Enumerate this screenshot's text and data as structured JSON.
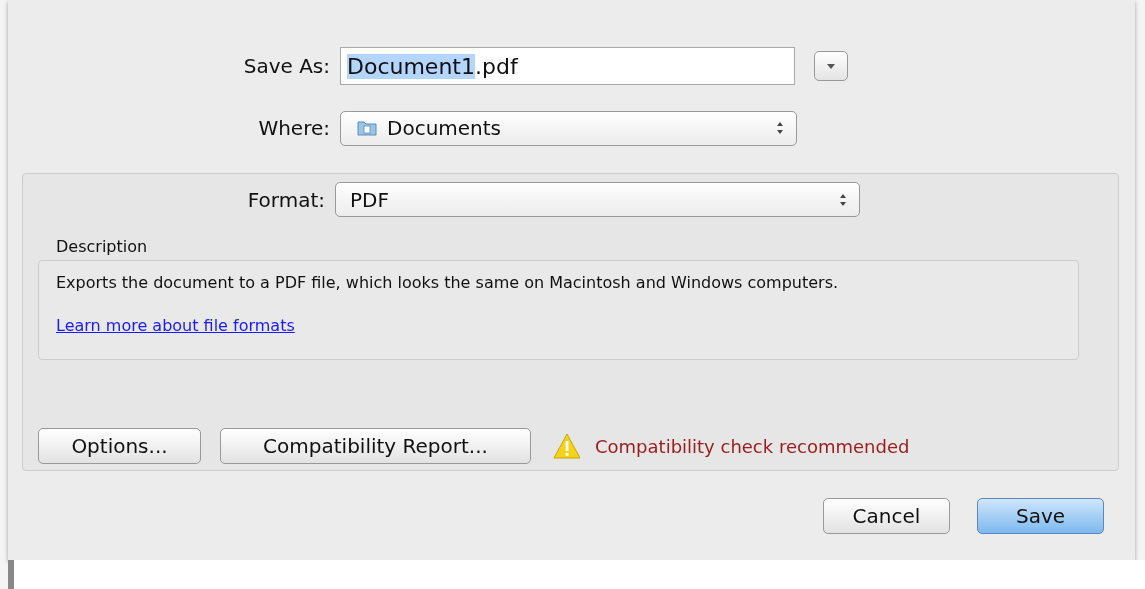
{
  "save_as": {
    "label": "Save As:",
    "name": "Document1",
    "extension": ".pdf",
    "name_selected": true
  },
  "where": {
    "label": "Where:",
    "value": "Documents"
  },
  "format": {
    "label": "Format:",
    "value": "PDF"
  },
  "description": {
    "label": "Description",
    "text": "Exports the document to a PDF file, which looks the same on Macintosh and Windows computers.",
    "link": "Learn more about file formats"
  },
  "option_buttons": [
    "Options...",
    "Compatibility Report..."
  ],
  "warning": "Compatibility check recommended",
  "buttons": [
    {
      "label": "Cancel",
      "default": false
    },
    {
      "label": "Save",
      "default": true
    }
  ]
}
